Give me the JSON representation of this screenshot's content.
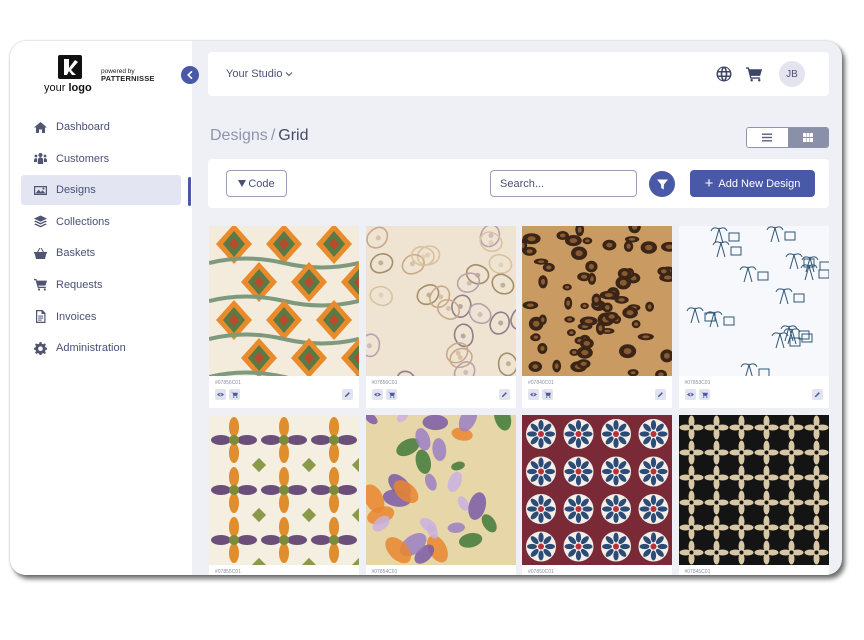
{
  "brand": {
    "logo_text_plain": "your ",
    "logo_text_bold": "logo",
    "powered_by": "powered by",
    "brand_name": "PATTERNISSE"
  },
  "sidebar": {
    "items": [
      {
        "label": "Dashboard",
        "icon": "home-icon",
        "active": false
      },
      {
        "label": "Customers",
        "icon": "users-icon",
        "active": false
      },
      {
        "label": "Designs",
        "icon": "image-icon",
        "active": true
      },
      {
        "label": "Collections",
        "icon": "layers-icon",
        "active": false
      },
      {
        "label": "Baskets",
        "icon": "basket-icon",
        "active": false
      },
      {
        "label": "Requests",
        "icon": "cart-icon",
        "active": false
      },
      {
        "label": "Invoices",
        "icon": "file-icon",
        "active": false
      },
      {
        "label": "Administration",
        "icon": "gear-icon",
        "active": false
      }
    ]
  },
  "topbar": {
    "studio": "Your Studio",
    "avatar_initials": "JB"
  },
  "page": {
    "breadcrumb_parent": "Designs",
    "breadcrumb_separator": "/",
    "breadcrumb_current": "Grid"
  },
  "filters": {
    "code_label": "Code",
    "search_placeholder": "Search...",
    "add_label": "Add New Design"
  },
  "designs": [
    {
      "code": "#07856C01",
      "pattern": "ikat"
    },
    {
      "code": "#07856C01",
      "pattern": "paisley"
    },
    {
      "code": "#07840C01",
      "pattern": "leopard"
    },
    {
      "code": "#07853C01",
      "pattern": "toile"
    },
    {
      "code": "#07855C01",
      "pattern": "tile-green"
    },
    {
      "code": "#07854C01",
      "pattern": "floral"
    },
    {
      "code": "#07850C01",
      "pattern": "tile-red"
    },
    {
      "code": "#07845C01",
      "pattern": "lattice"
    }
  ],
  "colors": {
    "accent": "#4a58a8",
    "background": "#eef0f5",
    "sidebar_active": "#e3e6f2"
  }
}
